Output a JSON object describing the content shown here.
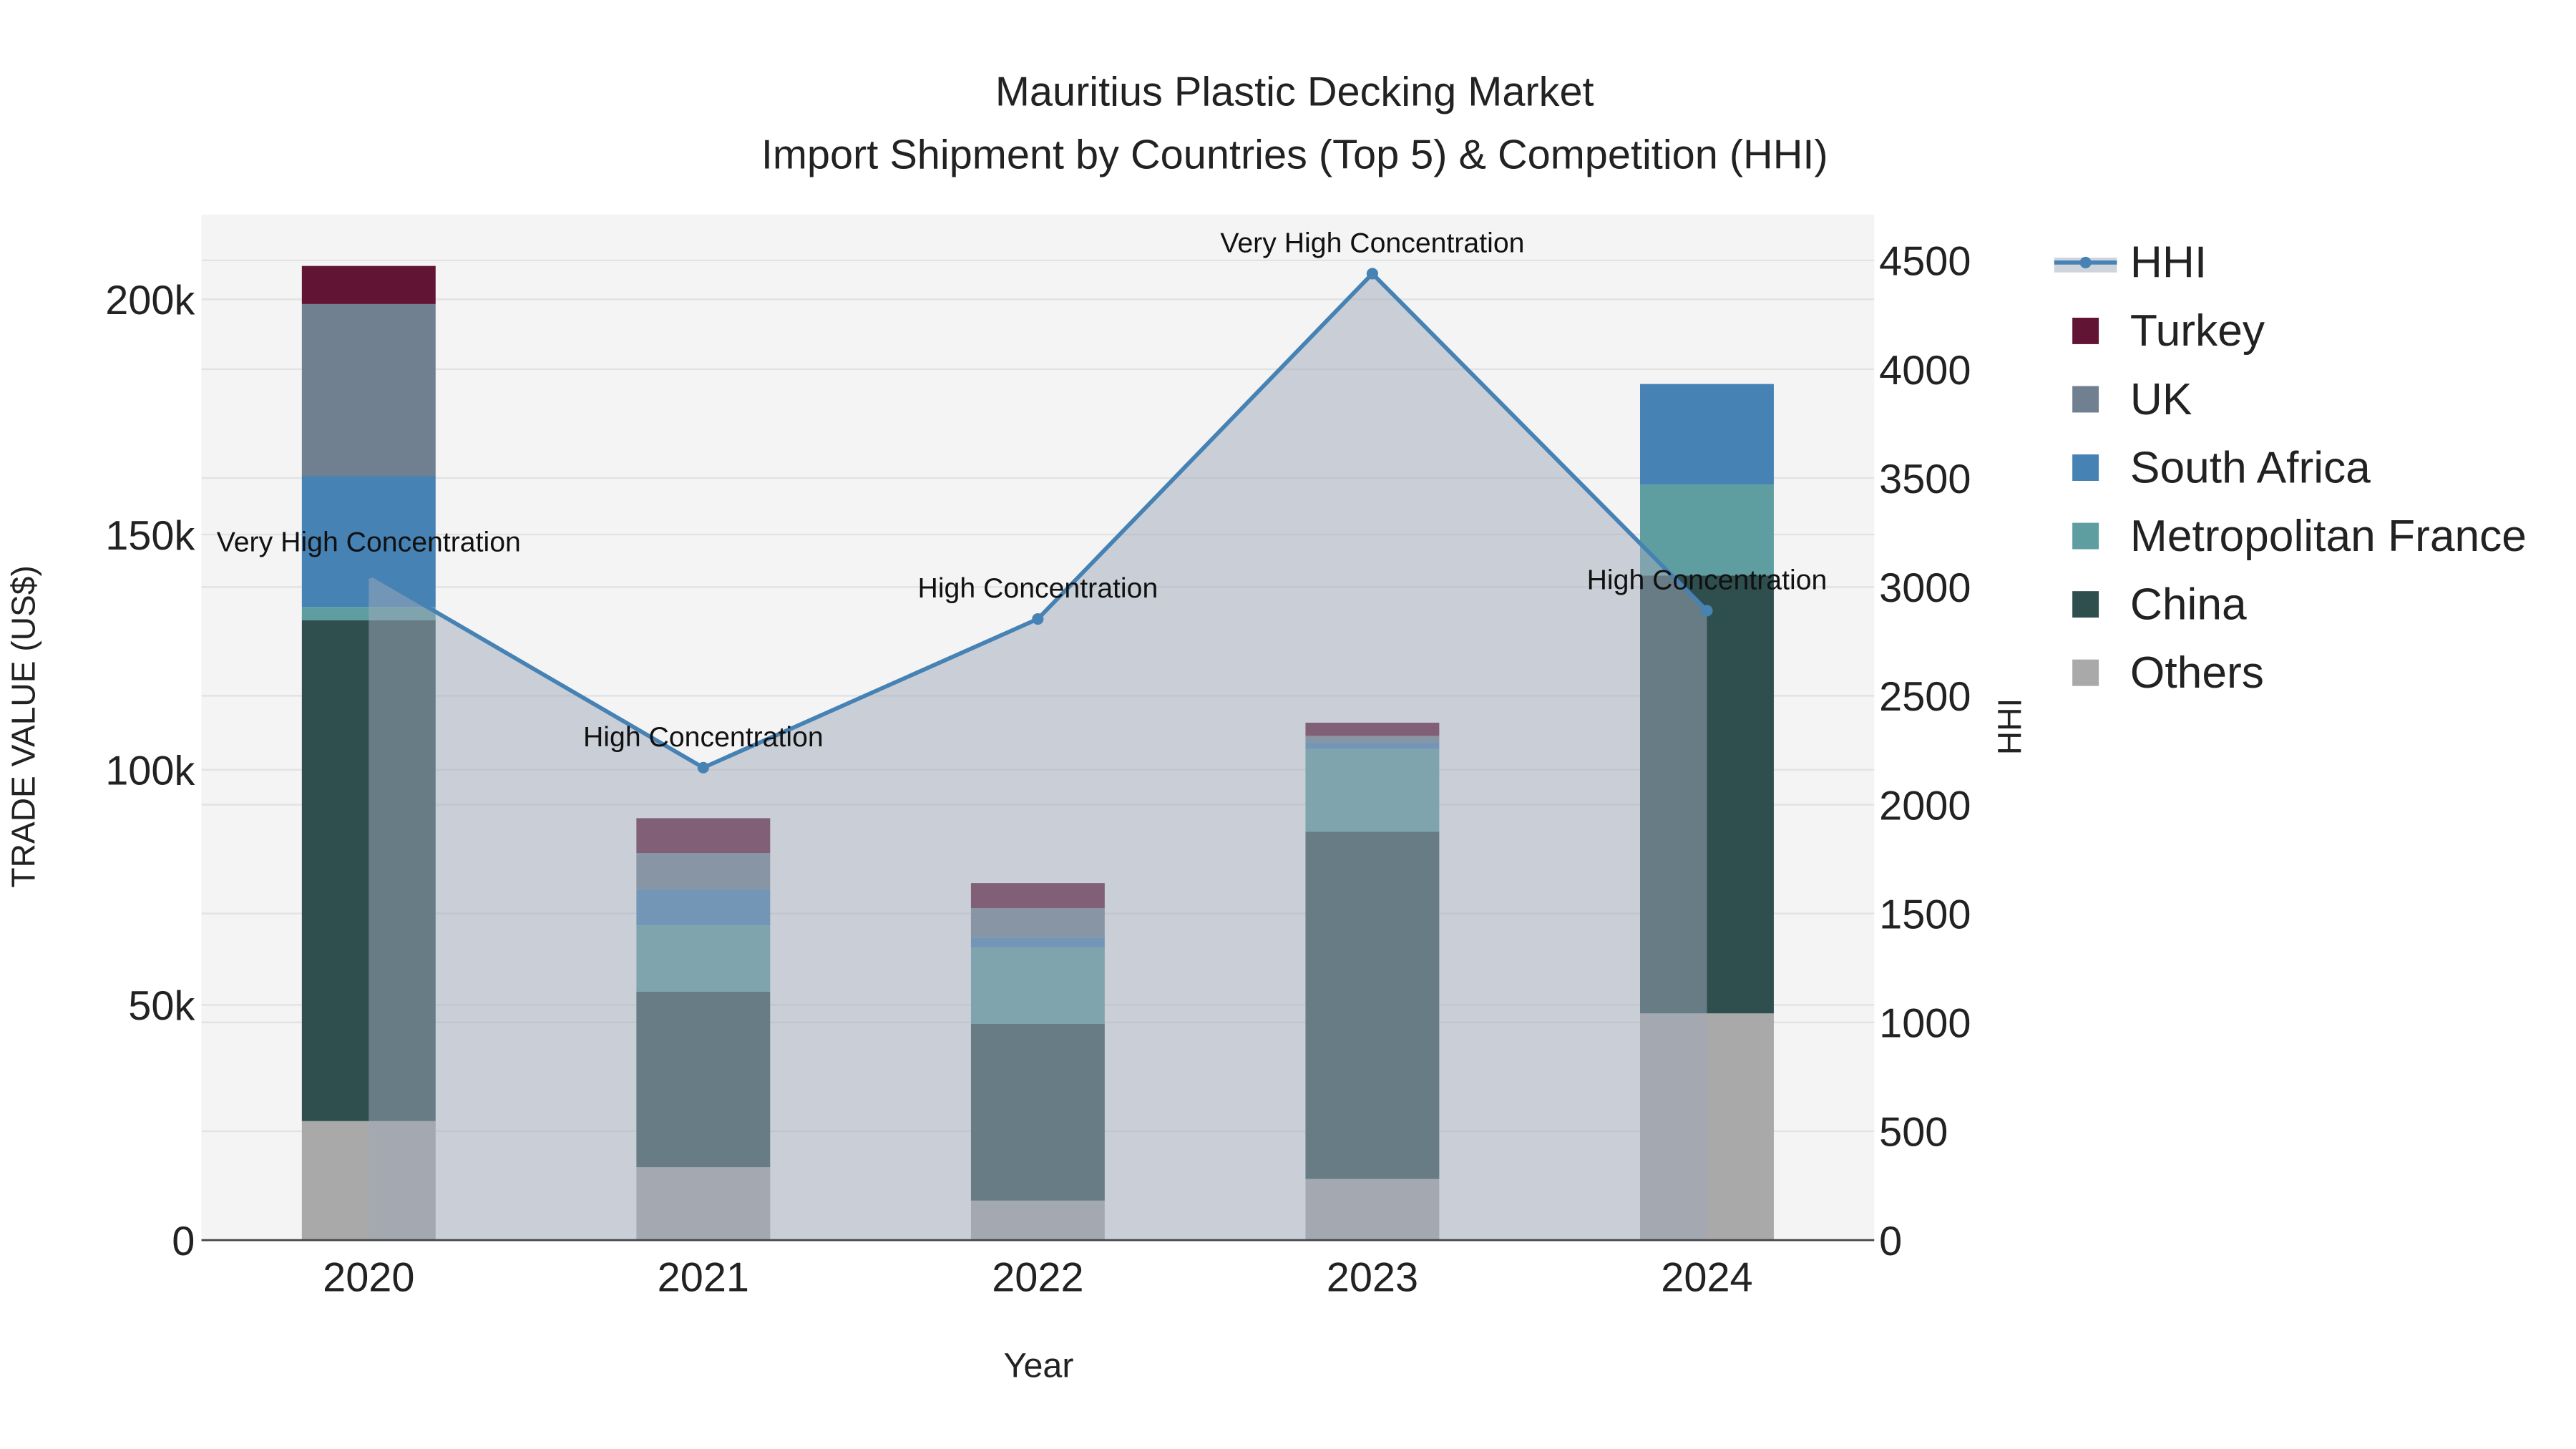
{
  "chart_data": {
    "type": "bar",
    "stacked": true,
    "title": "Mauritius Plastic Decking Market",
    "subtitle": "Import Shipment by Countries (Top 5) & Competition (HHI)",
    "xlabel": "Year",
    "ylabel": "TRADE VALUE (US$)",
    "y2label": "HHI",
    "categories": [
      "2020",
      "2021",
      "2022",
      "2023",
      "2024"
    ],
    "ylim": [
      0,
      218000
    ],
    "y_ticks": [
      0,
      50000,
      100000,
      150000,
      200000
    ],
    "y_tick_labels": [
      "0",
      "50k",
      "100k",
      "150k",
      "200k"
    ],
    "y2lim": [
      0,
      4710
    ],
    "y2_ticks": [
      0,
      500,
      1000,
      1500,
      2000,
      2500,
      3000,
      3500,
      4000,
      4500
    ],
    "y2_tick_labels": [
      "0",
      "500",
      "1000",
      "1500",
      "2000",
      "2500",
      "3000",
      "3500",
      "4000",
      "4500"
    ],
    "grid": true,
    "legend_position": "right",
    "series": [
      {
        "name": "Others",
        "color": "#a9a9a9",
        "values": [
          25300,
          15500,
          8400,
          13000,
          48200
        ]
      },
      {
        "name": "China",
        "color": "#2f4f4f",
        "values": [
          106500,
          37300,
          37600,
          73800,
          93100
        ]
      },
      {
        "name": "Metropolitan France",
        "color": "#5f9ea0",
        "values": [
          2800,
          14100,
          16200,
          17600,
          19300
        ]
      },
      {
        "name": "South Africa",
        "color": "#4682b4",
        "values": [
          27800,
          7700,
          2100,
          1400,
          21400
        ]
      },
      {
        "name": "UK",
        "color": "#708090",
        "values": [
          36600,
          7700,
          6300,
          1400,
          0
        ]
      },
      {
        "name": "Turkey",
        "color": "#621435",
        "values": [
          8100,
          7400,
          5300,
          2800,
          0
        ]
      }
    ],
    "hhi": {
      "name": "HHI",
      "color": "#4682b4",
      "values": [
        3065,
        2170,
        2853,
        4439,
        2891
      ],
      "annotations": [
        "Very High Concentration",
        "High Concentration",
        "High Concentration",
        "Very High Concentration",
        "High Concentration"
      ]
    },
    "legend_order": [
      "HHI",
      "Turkey",
      "UK",
      "South Africa",
      "Metropolitan France",
      "China",
      "Others"
    ]
  }
}
